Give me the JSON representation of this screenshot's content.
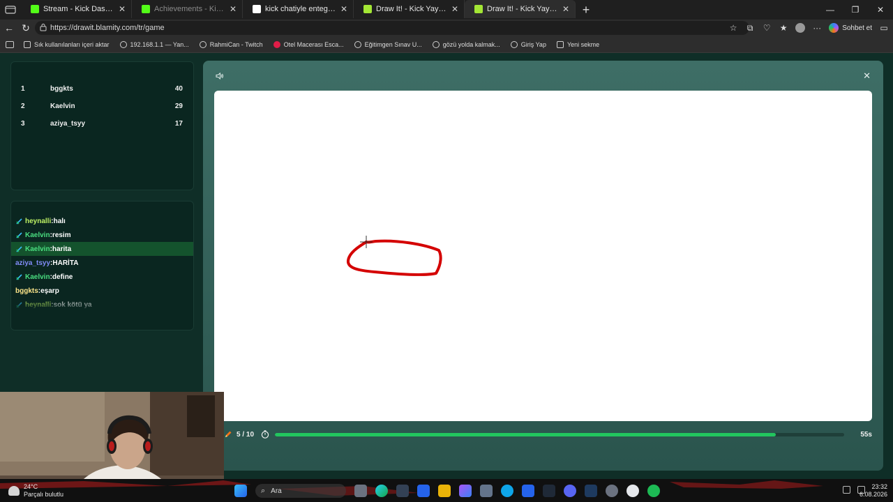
{
  "browser": {
    "tabs": [
      {
        "label": "Stream - Kick Dashboard",
        "favicon": "kick-icon",
        "active": false,
        "dim": false
      },
      {
        "label": "Achievements - Kick Dashboard",
        "favicon": "kick-icon",
        "active": false,
        "dim": true
      },
      {
        "label": "kick chatiyle entegre resim çizme oy",
        "favicon": "google-icon",
        "active": false,
        "dim": false
      },
      {
        "label": "Draw It! - Kick Yayınları İçin Çizim Oy",
        "favicon": "drawit-icon",
        "active": false,
        "dim": false
      },
      {
        "label": "Draw It! - Kick Yayınları İçin Çizim",
        "favicon": "drawit-icon",
        "active": true,
        "dim": false
      }
    ],
    "url": "https://drawit.blamity.com/tr/game",
    "copilot_label": "Sohbet et",
    "bookmarks": [
      {
        "label": "Sık kullanılanları içeri aktar",
        "icon": "import-icon"
      },
      {
        "label": "192.168.1.1 — Yan...",
        "icon": "globe-icon"
      },
      {
        "label": "RahmiCan - Twitch",
        "icon": "globe-icon"
      },
      {
        "label": "Otel Macerası Esca...",
        "icon": "youtube-icon"
      },
      {
        "label": "Eğitimgen Sınav U...",
        "icon": "globe-icon"
      },
      {
        "label": "gözü yolda kalmak...",
        "icon": "google-icon"
      },
      {
        "label": "Giriş Yap",
        "icon": "globe-icon"
      },
      {
        "label": "Yeni sekme",
        "icon": "newtab-icon"
      }
    ]
  },
  "leaderboard": [
    {
      "rank": "1",
      "name": "bggkts",
      "score": "40"
    },
    {
      "rank": "2",
      "name": "Kaelvin",
      "score": "29"
    },
    {
      "rank": "3",
      "name": "aziya_tsyy",
      "score": "17"
    }
  ],
  "chat": [
    {
      "user": "heynalli",
      "text": "halı",
      "badge": true,
      "color": "lime",
      "highlight": false
    },
    {
      "user": "Kaelvin",
      "text": "resim",
      "badge": true,
      "color": "green",
      "highlight": false
    },
    {
      "user": "Kaelvin",
      "text": "harita",
      "badge": true,
      "color": "green",
      "highlight": true
    },
    {
      "user": "aziya_tsyy",
      "text": "HARİTA",
      "badge": false,
      "color": "blue",
      "highlight": false
    },
    {
      "user": "Kaelvin",
      "text": "define",
      "badge": true,
      "color": "green",
      "highlight": false
    },
    {
      "user": "bggkts",
      "text": "eşarp",
      "badge": false,
      "color": "yellow",
      "highlight": false
    },
    {
      "user": "heynalli",
      "text": "sok kötü ya",
      "badge": true,
      "color": "lime",
      "highlight": false
    }
  ],
  "game": {
    "round": "5 / 10",
    "seconds_left": "55s",
    "progress_fraction": 0.88,
    "stroke_color": "#d40000"
  },
  "taskbar": {
    "temp": "24°C",
    "weather": "Parçalı bulutlu",
    "search": "Ara",
    "time": "23:32",
    "date": "6.08.2026"
  },
  "colors": {
    "page_bg": "#0f2e27",
    "panel_bg": "#0a2620",
    "accent_green": "#22c55e"
  }
}
